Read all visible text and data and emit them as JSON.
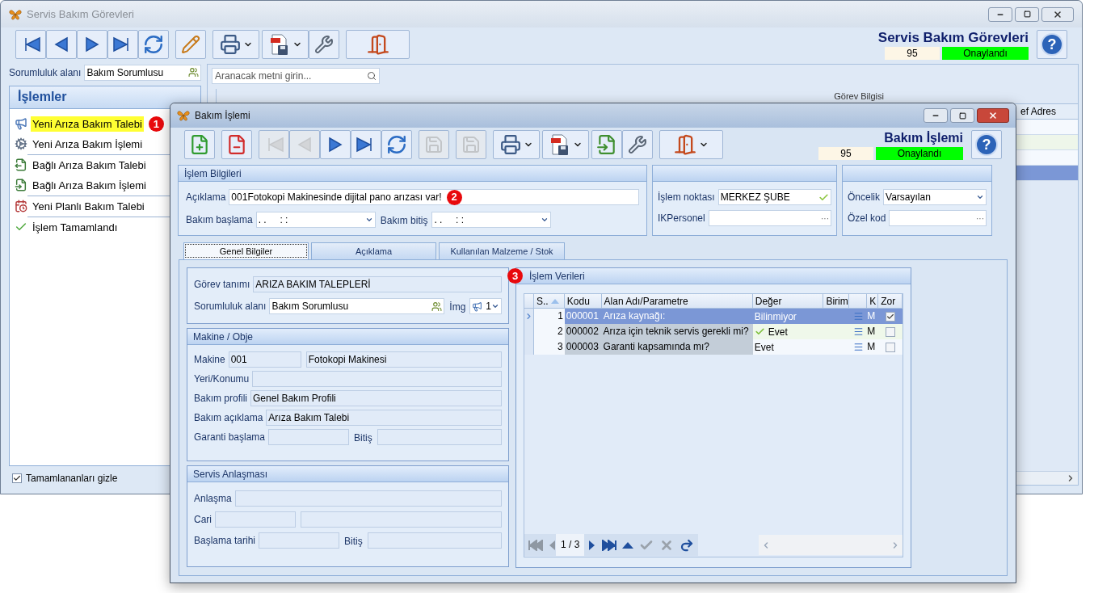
{
  "main_window": {
    "title": "Servis Bakım Görevleri",
    "toolbar": [
      {
        "kind": "first",
        "disabled": false,
        "dropdown": false
      },
      {
        "kind": "prev",
        "disabled": false,
        "dropdown": false
      },
      {
        "kind": "next",
        "disabled": false,
        "dropdown": false
      },
      {
        "kind": "last",
        "disabled": false,
        "dropdown": false
      },
      {
        "kind": "refresh",
        "disabled": false,
        "dropdown": false
      },
      {
        "kind": "edit",
        "disabled": false,
        "dropdown": false
      },
      {
        "kind": "print",
        "disabled": false,
        "dropdown": true
      },
      {
        "kind": "pdf",
        "disabled": false,
        "dropdown": true
      },
      {
        "kind": "tools",
        "disabled": false,
        "dropdown": false
      },
      {
        "kind": "exit",
        "disabled": false,
        "dropdown": false
      }
    ],
    "header": {
      "title": "Servis Bakım Görevleri",
      "number": "95",
      "status": "Onaylandı"
    },
    "help": "?",
    "responsibility": {
      "label": "Sorumluluk alanı",
      "value": "Bakım Sorumlusu"
    },
    "operations": {
      "title": "İşlemler",
      "items": [
        {
          "kind": "request",
          "label": "Yeni Arıza Bakım Talebi",
          "highlighted": true,
          "badge": "1",
          "divider": false
        },
        {
          "kind": "process",
          "label": "Yeni Arıza Bakım İşlemi",
          "highlighted": false,
          "divider": true
        },
        {
          "kind": "linked-request",
          "label": "Bağlı Arıza Bakım Talebi",
          "highlighted": false,
          "divider": false
        },
        {
          "kind": "linked-process",
          "label": "Bağlı Arıza Bakım İşlemi",
          "highlighted": false,
          "divider": true
        },
        {
          "kind": "planned",
          "label": "Yeni Planlı Bakım Talebi",
          "highlighted": false,
          "divider": true
        },
        {
          "kind": "done",
          "label": "İşlem Tamamlandı",
          "highlighted": false,
          "divider": false
        }
      ]
    },
    "hide_completed": {
      "label": "Tamamlananları gizle",
      "checked": true
    },
    "search": {
      "placeholder": "Aranacak metni girin..."
    },
    "grid": {
      "band": "Görev Bilgisi",
      "column": "ef Adres",
      "rows": [
        {
          "selected": false,
          "alt": false
        },
        {
          "selected": false,
          "alt": true
        },
        {
          "selected": false,
          "alt": false
        },
        {
          "selected": true
        }
      ]
    }
  },
  "dialog": {
    "title": "Bakım İşlemi",
    "toolbar": [
      {
        "kind": "new",
        "disabled": false,
        "dropdown": false
      },
      {
        "kind": "delete",
        "disabled": false,
        "dropdown": false
      },
      {
        "kind": "first",
        "disabled": true,
        "dropdown": false
      },
      {
        "kind": "prev",
        "disabled": true,
        "dropdown": false
      },
      {
        "kind": "next",
        "disabled": false,
        "dropdown": false
      },
      {
        "kind": "last",
        "disabled": false,
        "dropdown": false
      },
      {
        "kind": "refresh",
        "disabled": false,
        "dropdown": false
      },
      {
        "kind": "save",
        "disabled": true,
        "dropdown": false
      },
      {
        "kind": "cancel-save",
        "disabled": true,
        "dropdown": false
      },
      {
        "kind": "print",
        "disabled": false,
        "dropdown": true
      },
      {
        "kind": "pdf",
        "disabled": false,
        "dropdown": true
      },
      {
        "kind": "import",
        "disabled": false,
        "dropdown": false
      },
      {
        "kind": "tools",
        "disabled": false,
        "dropdown": false
      },
      {
        "kind": "exit",
        "disabled": false,
        "dropdown": true
      }
    ],
    "header": {
      "title": "Bakım İşlemi",
      "number": "95",
      "status": "Onaylandı"
    },
    "help": "?",
    "info": {
      "title": "İşlem Bilgileri",
      "description": {
        "label": "Açıklama",
        "value": "001Fotokopi Makinesinde dijital pano arızası var!",
        "badge": "2"
      },
      "start": {
        "label": "Bakım başlama",
        "value": ". .     : :"
      },
      "end": {
        "label": "Bakım bitiş",
        "value": ". .     : :"
      }
    },
    "location": {
      "fields": [
        {
          "kind": "check",
          "label": "İşlem noktası",
          "value": "MERKEZ ŞUBE"
        },
        {
          "kind": "ellipsis",
          "label": "IKPersonel",
          "button": "···"
        }
      ]
    },
    "priority": {
      "fields": [
        {
          "kind": "dropdown",
          "label": "Öncelik",
          "value": "Varsayılan"
        },
        {
          "kind": "ellipsis",
          "label": "Özel kod",
          "button": "···"
        }
      ]
    },
    "tabs": [
      {
        "label": "Genel Bilgiler",
        "selected": true
      },
      {
        "label": "Açıklama",
        "selected": false
      },
      {
        "label": "Kullanılan Malzeme / Stok",
        "selected": false
      }
    ],
    "task": {
      "definition": {
        "label": "Görev tanımı",
        "value": "ARIZA BAKIM TALEPLERİ"
      },
      "responsibility": {
        "label": "Sorumluluk alanı",
        "value": "Bakım Sorumlusu"
      },
      "image": {
        "label": "İmg",
        "value": "1"
      }
    },
    "machine": {
      "title": "Makine / Obje",
      "machine": {
        "label": "Makine",
        "code": "001",
        "name": "Fotokopi Makinesi"
      },
      "location": {
        "label": "Yeri/Konumu"
      },
      "profile": {
        "label": "Bakım profili",
        "value": "Genel Bakım Profili"
      },
      "description": {
        "label": "Bakım açıklama",
        "value": "Arıza Bakım Talebi"
      },
      "warranty": {
        "label": "Garanti başlama",
        "end_label": "Bitiş"
      }
    },
    "service": {
      "title": "Servis Anlaşması",
      "agreement": {
        "label": "Anlaşma"
      },
      "account": {
        "label": "Cari"
      },
      "start": {
        "label": "Başlama tarihi",
        "end_label": "Bitiş"
      }
    },
    "data": {
      "title": "İşlem Verileri",
      "badge": "3",
      "columns": [
        "S..",
        "Kodu",
        "Alan Adı/Parametre",
        "Değer",
        "Birim",
        "K",
        "Zor"
      ],
      "rows": [
        {
          "no": "1",
          "code": "000001",
          "name": "Arıza kaynağı:",
          "value": "Bilinmiyor",
          "confirmed": false,
          "unit_kind": "M",
          "required": true,
          "selected": true
        },
        {
          "no": "2",
          "code": "000002",
          "name": "Arıza için teknik servis gerekli mi?",
          "value": "Evet",
          "confirmed": true,
          "unit_kind": "M",
          "required": false,
          "selected": false
        },
        {
          "no": "3",
          "code": "000003",
          "name": "Garanti kapsamında mı?",
          "value": "Evet",
          "confirmed": false,
          "unit_kind": "M",
          "required": false,
          "selected": false
        }
      ],
      "pager": "1 / 3"
    }
  }
}
